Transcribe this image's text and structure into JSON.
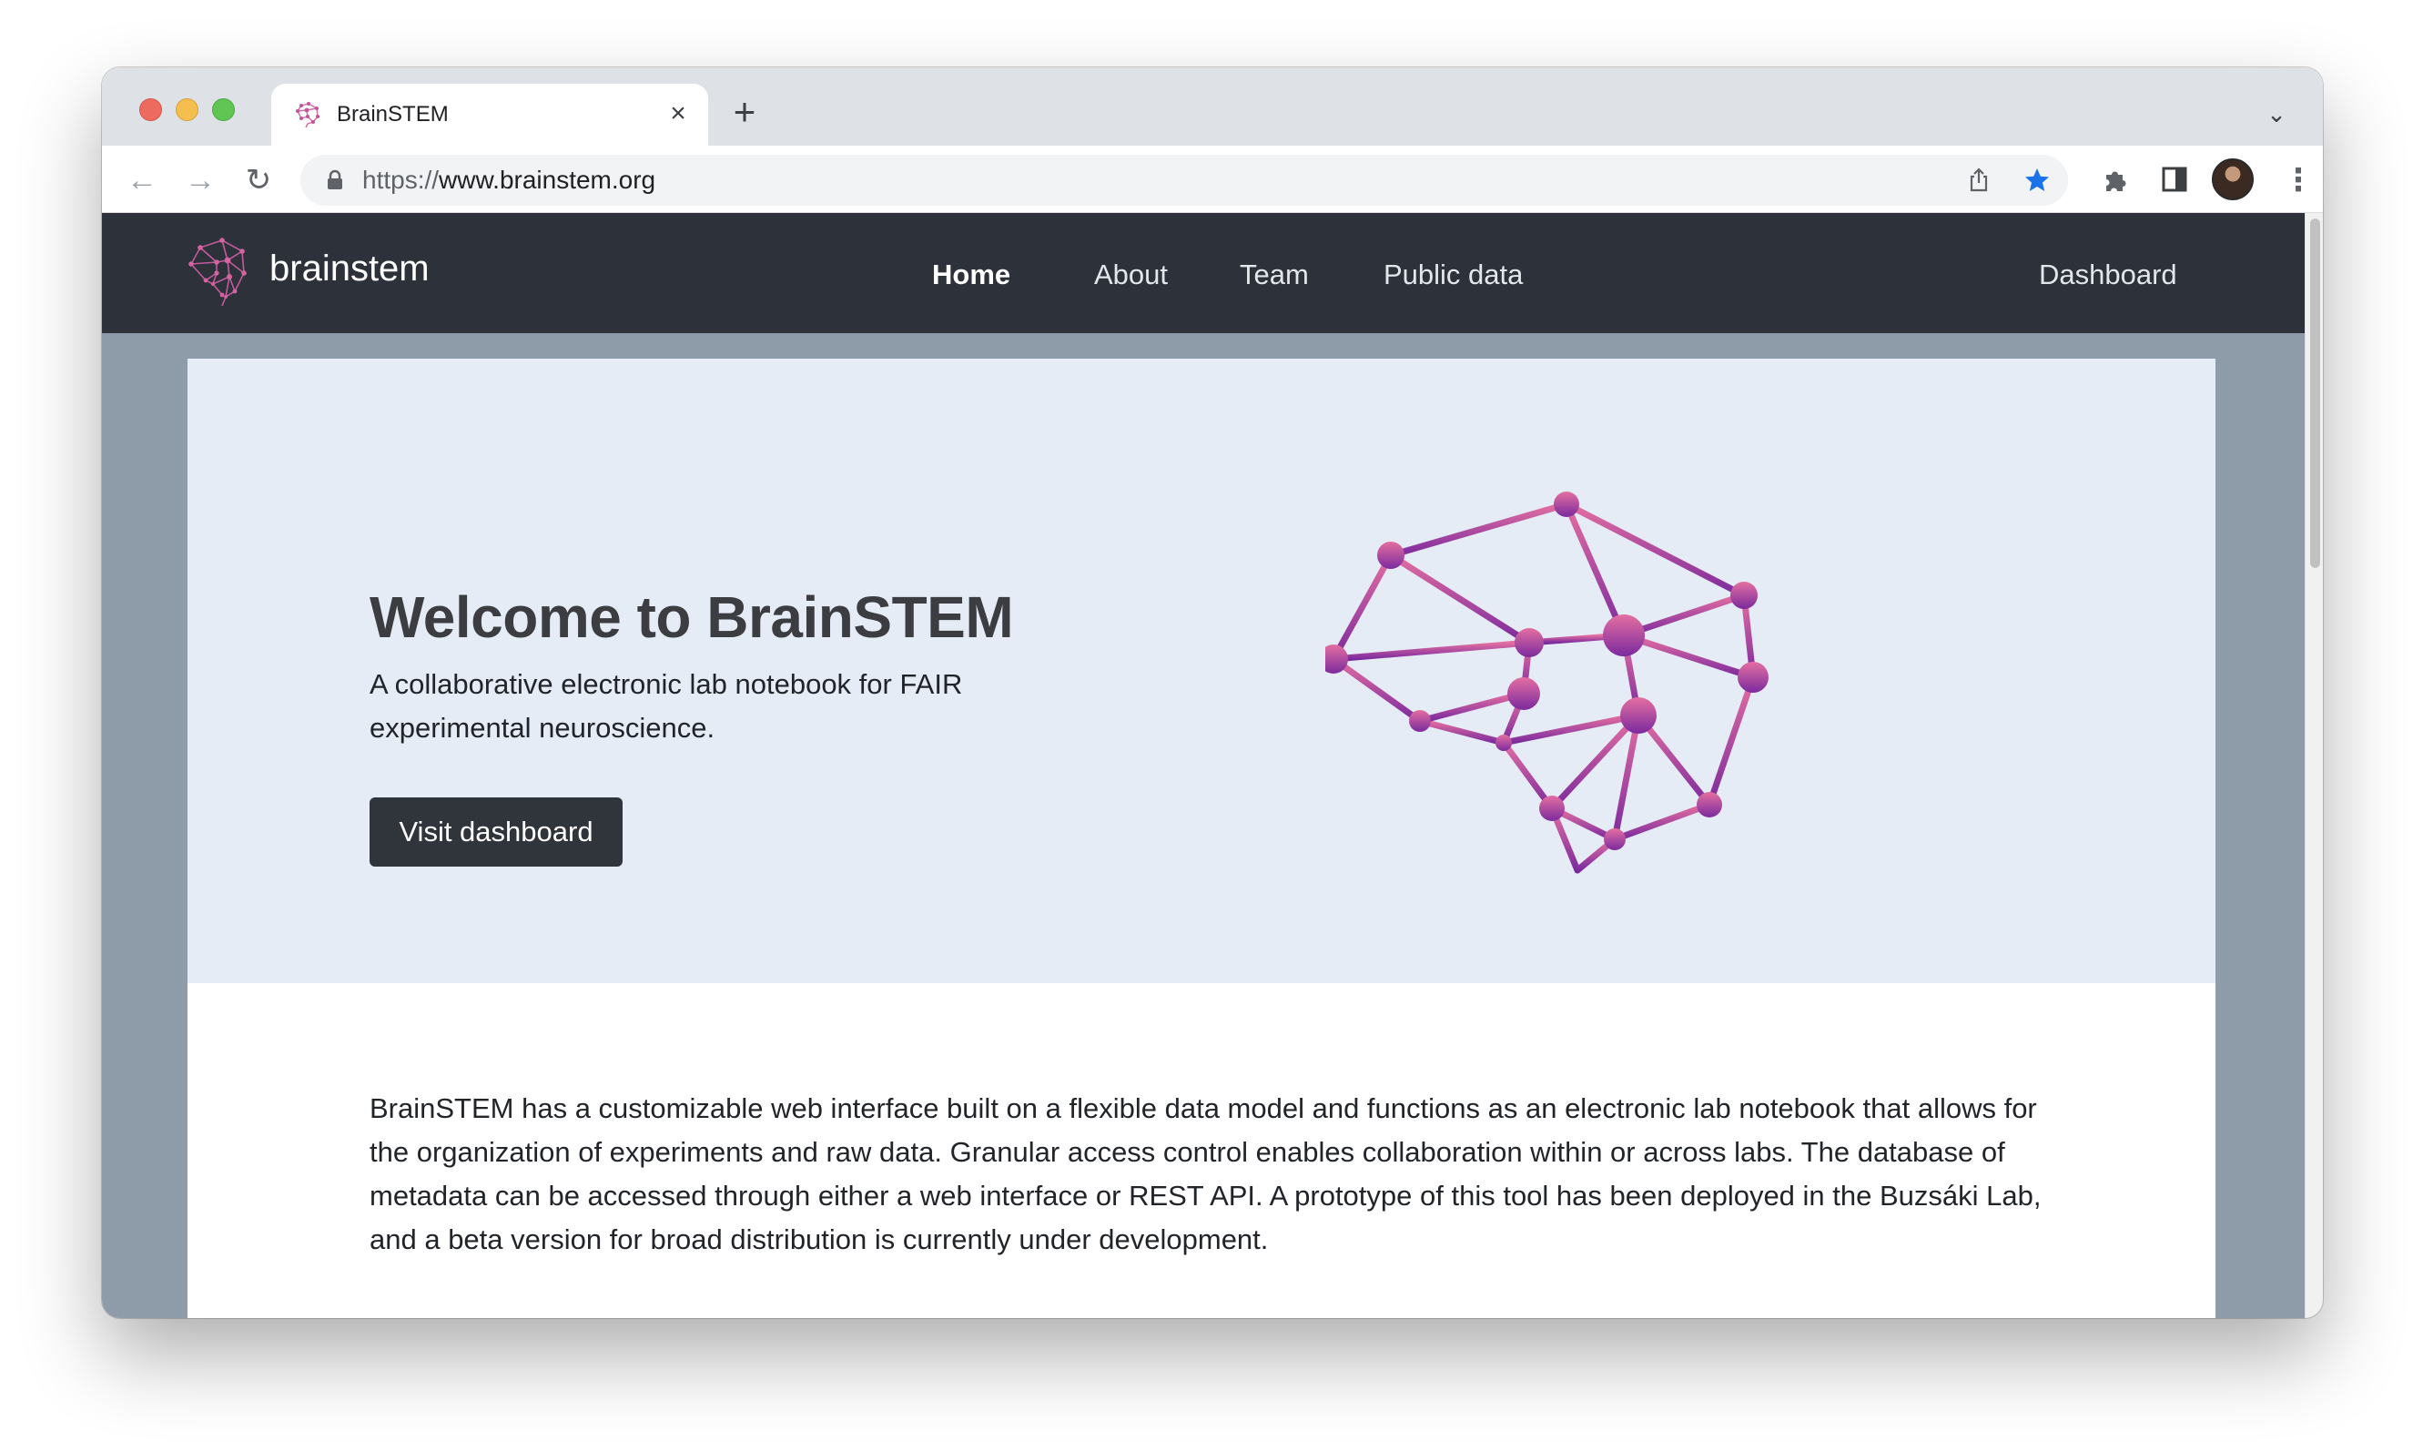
{
  "browser": {
    "tab_title": "BrainSTEM",
    "tab_close": "×",
    "new_tab": "+",
    "tab_search": "⌄",
    "back": "←",
    "forward": "→",
    "reload": "↻",
    "menu": "⋮",
    "url_scheme": "https://",
    "url_host": "www.brainstem.org",
    "bookmark_color": "#1a73e8"
  },
  "navbar": {
    "brand": "brainstem",
    "links": [
      "Home",
      "About",
      "Team",
      "Public data"
    ],
    "active_link": "Home",
    "dashboard": "Dashboard",
    "background": "#2c313a"
  },
  "hero": {
    "title": "Welcome to BrainSTEM",
    "subtitle": "A collaborative electronic lab notebook for FAIR experimental neuroscience.",
    "button": "Visit dashboard",
    "accent_top": "#e46fa1",
    "accent_bottom": "#7b2a9e"
  },
  "intro": {
    "text": "BrainSTEM has a customizable web interface built on a flexible data model and functions as an electronic lab notebook that allows for the organization of experiments and raw data. Granular access control enables collaboration within or across labs. The database of metadata can be accessed through either a web interface or REST API. A prototype of this tool has been deployed in the Buzsáki Lab, and a beta version for broad distribution is currently under development."
  }
}
